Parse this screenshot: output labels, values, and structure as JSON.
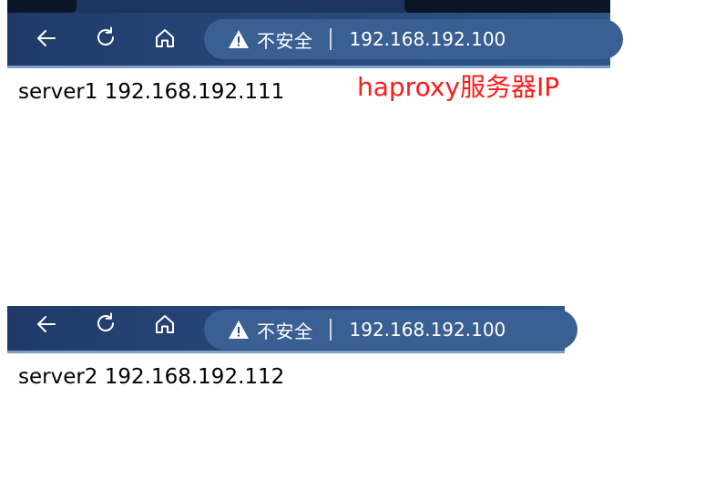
{
  "browser_windows": [
    {
      "security_label": "不安全",
      "url": "192.168.192.100",
      "page_content": "server1 192.168.192.111"
    },
    {
      "security_label": "不安全",
      "url": "192.168.192.100",
      "page_content": "server2 192.168.192.112"
    }
  ],
  "annotation": {
    "text": "haproxy服务器IP",
    "color": "#ff1a1a"
  },
  "icons": {
    "back": "back-arrow-icon",
    "reload": "reload-icon",
    "home": "home-icon",
    "warning": "warning-icon"
  },
  "colors": {
    "toolbar": "#27477a",
    "address_bar": "#3a5f93"
  }
}
